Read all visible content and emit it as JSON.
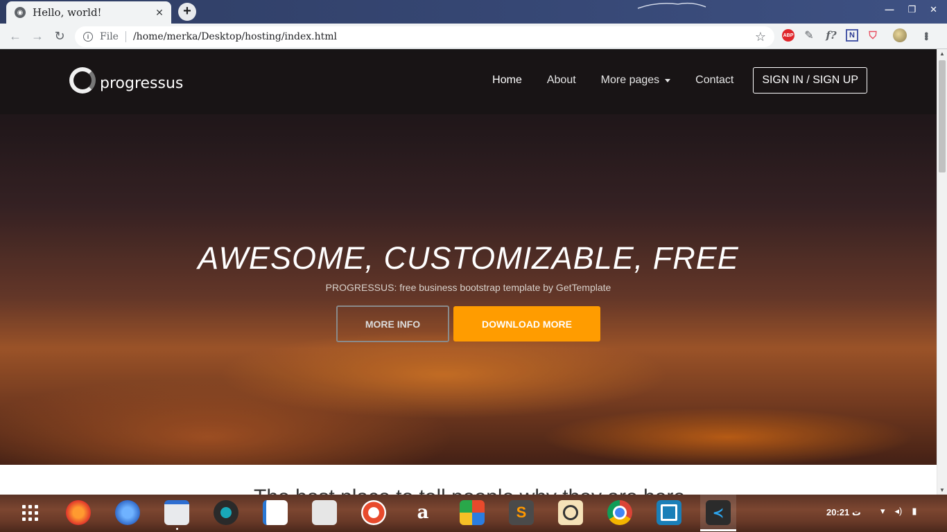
{
  "browser": {
    "tab_title": "Hello,  world!",
    "tab_close": "✕",
    "new_tab": "+",
    "address_security_label": "File",
    "address_url": "/home/merka/Desktop/hosting/index.html",
    "window_controls": [
      "—",
      "❐",
      "✕"
    ],
    "extensions": [
      "adblock-plus-icon",
      "pen-extension-icon",
      "formula-extension-icon",
      "notion-extension-icon",
      "privacy-shield-icon"
    ],
    "extension_labels": {
      "abp": "ABP",
      "f": "f?",
      "n": "N"
    }
  },
  "site": {
    "brand_name": "progressus",
    "nav": {
      "home": "Home",
      "about": "About",
      "more_pages": "More pages",
      "contact": "Contact",
      "signin": "SIGN IN / SIGN UP"
    },
    "hero": {
      "title": "AWESOME, CUSTOMIZABLE, FREE",
      "subtitle": "PROGRESSUS: free business bootstrap template by GetTemplate",
      "btn_more_info": "MORE INFO",
      "btn_download": "DOWNLOAD MORE"
    },
    "below_heading": "The best place to tell people why they are here"
  },
  "taskbar": {
    "apps": [
      "firefox",
      "thunderbird",
      "files",
      "music-player",
      "documents",
      "software-store",
      "help",
      "amazon",
      "app-mosaic",
      "sublime-text",
      "camera",
      "chrome",
      "virtual-machine",
      "vscode"
    ],
    "clock": "20:21 ت"
  },
  "colors": {
    "accent_orange": "#ff9c00",
    "nav_bg": "#181416",
    "tabbar_blue": "#364774"
  }
}
